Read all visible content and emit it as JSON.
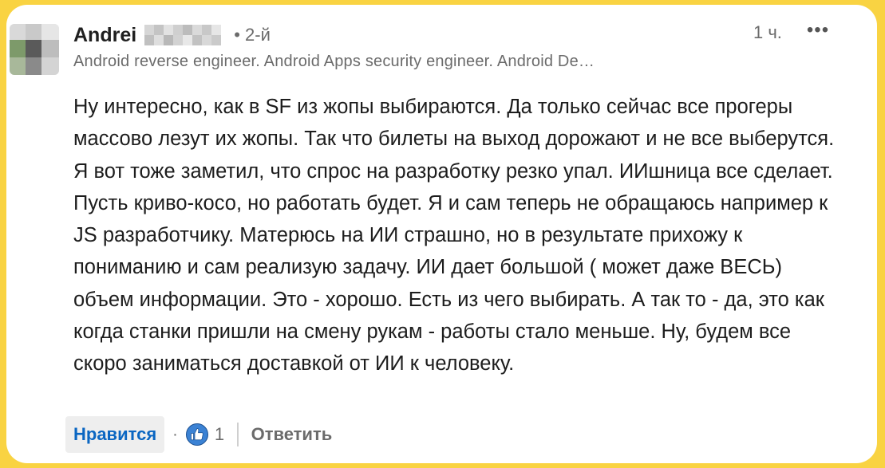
{
  "comment": {
    "author_name": "Andrei",
    "degree": "• 2-й",
    "headline": "Android reverse engineer. Android Apps security engineer. Android De…",
    "time": "1 ч.",
    "more_icon": "more-horizontal-icon",
    "text": "Ну интересно, как в SF из жопы выбираются. Да только сейчас все прогеры массово лезут их жопы. Так что билеты на выход дорожают и не все выберутся. Я вот тоже заметил, что спрос на разработку резко упал. ИИшница все сделает. Пусть криво-косо, но работать будет. Я и сам теперь не обращаюсь например к JS разработчику. Матерюсь на ИИ страшно, но в результате прихожу к пониманию и сам реализую задачу. ИИ дает большой ( может даже ВЕСЬ) объем информации. Это - хорошо. Есть из чего выбирать. А так то - да, это как когда станки пришли на смену рукам - работы стало меньше. Ну, будем все скоро заниматься доставкой от ИИ к человеку."
  },
  "actions": {
    "like_label": "Нравится",
    "dot": "·",
    "reaction_icon": "thumbs-up-icon",
    "reaction_count": "1",
    "reply_label": "Ответить"
  },
  "colors": {
    "frame": "#f9d342",
    "link_blue": "#0a66c2",
    "muted_text": "#6b6b6b"
  }
}
